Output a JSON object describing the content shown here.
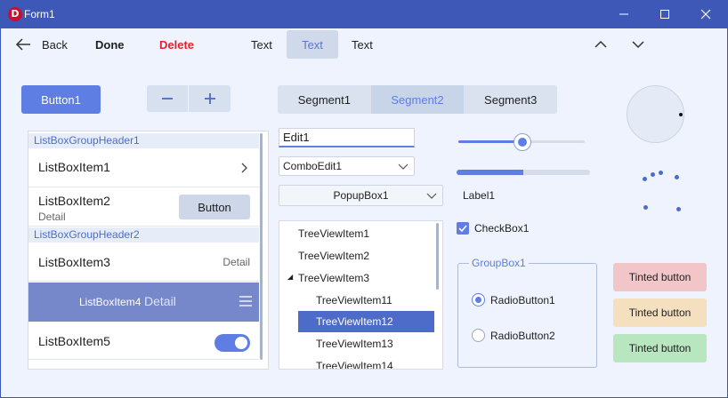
{
  "window": {
    "title": "Form1",
    "app_icon_letter": "D"
  },
  "toolbar": {
    "back_label": "Back",
    "done_label": "Done",
    "delete_label": "Delete",
    "text1": "Text",
    "text2": "Text",
    "text3": "Text"
  },
  "button1": {
    "label": "Button1"
  },
  "segments": [
    {
      "label": "Segment1"
    },
    {
      "label": "Segment2"
    },
    {
      "label": "Segment3"
    }
  ],
  "listbox": {
    "group1": "ListBoxGroupHeader1",
    "group2": "ListBoxGroupHeader2",
    "items": [
      {
        "label": "ListBoxItem1"
      },
      {
        "label": "ListBoxItem2",
        "detail": "Detail",
        "button": "Button"
      },
      {
        "label": "ListBoxItem3",
        "detail": "Detail"
      },
      {
        "label": "ListBoxItem4",
        "detail": "Detail"
      },
      {
        "label": "ListBoxItem5"
      }
    ]
  },
  "edit1": {
    "value": "Edit1"
  },
  "combo": {
    "value": "ComboEdit1"
  },
  "popup": {
    "value": "PopupBox1"
  },
  "tree": {
    "items": [
      {
        "label": "TreeViewItem1"
      },
      {
        "label": "TreeViewItem2"
      },
      {
        "label": "TreeViewItem3"
      },
      {
        "label": "TreeViewItem11"
      },
      {
        "label": "TreeViewItem12"
      },
      {
        "label": "TreeViewItem13"
      },
      {
        "label": "TreeViewItem14"
      }
    ]
  },
  "slider": {
    "value": 0.5
  },
  "progress": {
    "value": 0.5
  },
  "label1": "Label1",
  "checkbox": {
    "label": "CheckBox1",
    "checked": true
  },
  "groupbox": {
    "title": "GroupBox1",
    "radio1": "RadioButton1",
    "radio2": "RadioButton2"
  },
  "tinted": [
    {
      "label": "Tinted button",
      "color": "#f2c6c8"
    },
    {
      "label": "Tinted button",
      "color": "#f4e0bf"
    },
    {
      "label": "Tinted button",
      "color": "#b8e6bf"
    }
  ],
  "colors": {
    "accent": "#5e7ee3",
    "titlebar": "#3d58b6",
    "delete": "#e3202b",
    "selected": "#4d6bc9"
  }
}
